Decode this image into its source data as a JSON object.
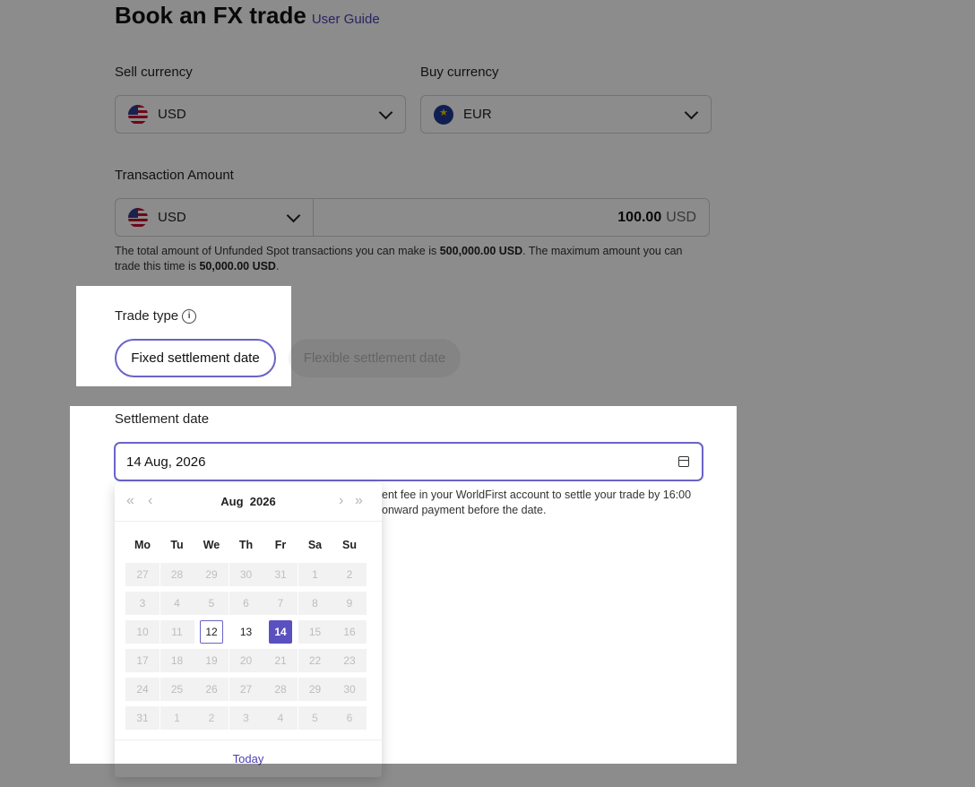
{
  "header": {
    "title": "Book an FX trade",
    "user_guide": "User Guide"
  },
  "sell": {
    "label": "Sell currency",
    "value": "USD",
    "flag_icon": "us-flag-icon"
  },
  "buy": {
    "label": "Buy currency",
    "value": "EUR",
    "flag_icon": "eu-flag-icon"
  },
  "amount": {
    "label": "Transaction Amount",
    "currency": "USD",
    "value": "100.00",
    "unit": "USD"
  },
  "limits_note": {
    "part1": "The total amount of Unfunded Spot transactions you can make is ",
    "total_limit": "500,000.00 USD",
    "part2": ". The maximum amount you can trade this time is ",
    "max_limit": "50,000.00 USD",
    "part3": "."
  },
  "trade_type": {
    "label": "Trade type",
    "options": [
      "Fixed settlement date",
      "Flexible settlement date"
    ],
    "selected": "Fixed settlement date"
  },
  "settlement": {
    "label": "Settlement date",
    "value": "14 Aug, 2026",
    "help_line1": "ent fee in your WorldFirst account to settle your trade by 16:00",
    "help_line2": "onward payment before the date."
  },
  "calendar": {
    "month": "Aug",
    "year": "2026",
    "weekdays": [
      "Mo",
      "Tu",
      "We",
      "Th",
      "Fr",
      "Sa",
      "Su"
    ],
    "weeks": [
      [
        "27",
        "28",
        "29",
        "30",
        "31",
        "1",
        "2"
      ],
      [
        "3",
        "4",
        "5",
        "6",
        "7",
        "8",
        "9"
      ],
      [
        "10",
        "11",
        "12",
        "13",
        "14",
        "15",
        "16"
      ],
      [
        "17",
        "18",
        "19",
        "20",
        "21",
        "22",
        "23"
      ],
      [
        "24",
        "25",
        "26",
        "27",
        "28",
        "29",
        "30"
      ],
      [
        "31",
        "1",
        "2",
        "3",
        "4",
        "5",
        "6"
      ]
    ],
    "today": "12",
    "selected": "14",
    "available": [
      "12",
      "13",
      "14"
    ],
    "today_label": "Today"
  },
  "colors": {
    "accent": "#5a50c0",
    "link": "#4a3fb5",
    "overlay": "rgba(0,0,0,0.45)"
  }
}
